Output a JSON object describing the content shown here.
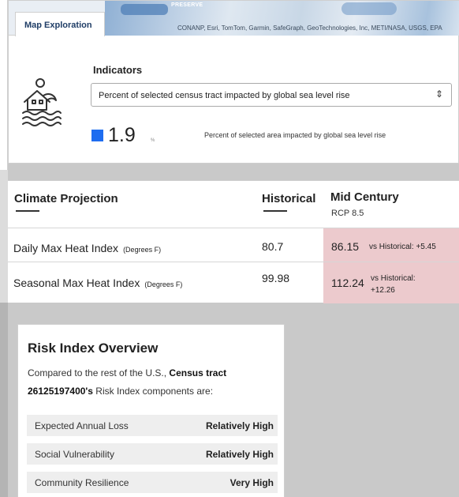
{
  "map": {
    "preserve_label": "PRESERVE",
    "attribution": "CONANP, Esri, TomTom, Garmin, SafeGraph, GeoTechnologies, Inc, METI/NASA, USGS, EPA"
  },
  "tabs": [
    {
      "label": "Map Exploration"
    }
  ],
  "indicators": {
    "title": "Indicators",
    "selected": "Percent of selected census tract impacted by global sea level rise",
    "value": "1.9",
    "unit": "%",
    "caption": "Percent of selected area impacted by global sea level rise",
    "swatch_color": "#1e6df0",
    "icon": "flooded-house-icon"
  },
  "climate_table": {
    "headers": {
      "projection": "Climate Projection",
      "historical": "Historical",
      "mid_century": "Mid Century",
      "mid_century_sub": "RCP 8.5"
    },
    "rows": [
      {
        "name": "Daily Max Heat Index",
        "unit": "(Degrees F)",
        "historical": "80.7",
        "mid": "86.15",
        "note": "vs Historical: +5.45"
      },
      {
        "name": "Seasonal Max Heat Index",
        "unit": "(Degrees F)",
        "historical": "99.98",
        "mid": "112.24",
        "note_line1": "vs Historical:",
        "note_line2": "+12.26"
      }
    ],
    "highlight_color": "#eccacd"
  },
  "risk": {
    "title": "Risk Index Overview",
    "desc_prefix": "Compared to the rest of the U.S., ",
    "desc_tract": "Census tract 26125197400's",
    "desc_suffix": " Risk Index components are:",
    "rows": [
      {
        "label": "Expected Annual Loss",
        "value": "Relatively High"
      },
      {
        "label": "Social Vulnerability",
        "value": "Relatively High"
      },
      {
        "label": "Community Resilience",
        "value": "Very High"
      }
    ]
  }
}
